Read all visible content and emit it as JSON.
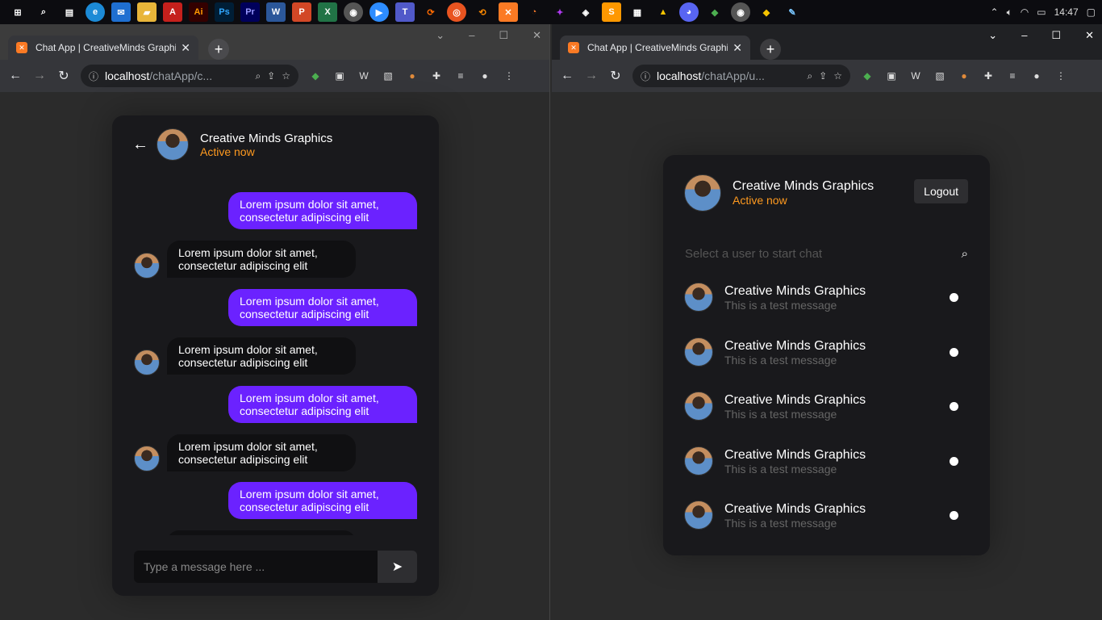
{
  "taskbar": {
    "time": "14:47"
  },
  "left_window": {
    "tab_title": "Chat App | CreativeMinds Graphics",
    "url_host": "localhost",
    "url_path": "/chatApp/c..."
  },
  "right_window": {
    "tab_title": "Chat App | CreativeMinds Graphics",
    "url_host": "localhost",
    "url_path": "/chatApp/u..."
  },
  "chat": {
    "user_name": "Creative Minds Graphics",
    "status": "Active now",
    "messages": [
      {
        "dir": "out",
        "text": "Lorem ipsum dolor sit amet, consectetur adipiscing elit"
      },
      {
        "dir": "in",
        "text": "Lorem ipsum dolor sit amet, consectetur adipiscing elit"
      },
      {
        "dir": "out",
        "text": "Lorem ipsum dolor sit amet, consectetur adipiscing elit"
      },
      {
        "dir": "in",
        "text": "Lorem ipsum dolor sit amet, consectetur adipiscing elit"
      },
      {
        "dir": "out",
        "text": "Lorem ipsum dolor sit amet, consectetur adipiscing elit"
      },
      {
        "dir": "in",
        "text": "Lorem ipsum dolor sit amet, consectetur adipiscing elit"
      },
      {
        "dir": "out",
        "text": "Lorem ipsum dolor sit amet, consectetur adipiscing elit"
      }
    ],
    "input_placeholder": "Type a message here ..."
  },
  "users_panel": {
    "user_name": "Creative Minds Graphics",
    "status": "Active now",
    "logout_label": "Logout",
    "search_placeholder": "Select a user to start chat",
    "users": [
      {
        "name": "Creative Minds Graphics",
        "message": "This is a test message"
      },
      {
        "name": "Creative Minds Graphics",
        "message": "This is a test message"
      },
      {
        "name": "Creative Minds Graphics",
        "message": "This is a test message"
      },
      {
        "name": "Creative Minds Graphics",
        "message": "This is a test message"
      },
      {
        "name": "Creative Minds Graphics",
        "message": "This is a test message"
      }
    ]
  },
  "colors": {
    "accent_purple": "#6b22ff",
    "status_orange": "#ff9a1f",
    "card_bg": "#19191c"
  }
}
